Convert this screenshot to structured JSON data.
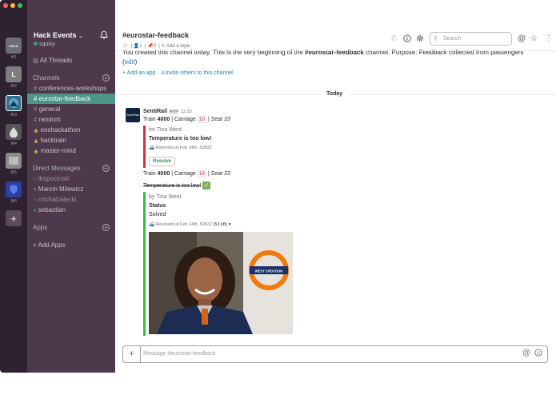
{
  "teams": {
    "items": [
      {
        "label": "HACK",
        "key": "⌘1",
        "color": "#6b6e73"
      },
      {
        "label": "L",
        "key": "⌘2",
        "color": "#7e7e80"
      },
      {
        "label": "",
        "key": "⌘3",
        "color": "#2f6f8a"
      },
      {
        "label": "",
        "key": "⌘4",
        "color": "#555"
      },
      {
        "label": "",
        "key": "⌘5",
        "color": "#8a8a8a"
      },
      {
        "label": "",
        "key": "⌘6",
        "color": "#2b3fa1"
      }
    ],
    "add": "+"
  },
  "sidebar": {
    "workspace": "Hack Events",
    "workspace_caret": "⌄",
    "username": "squixy",
    "all_threads": "All Threads",
    "channels_heading": "Channels",
    "channels": [
      {
        "prefix": "#",
        "label": "conferences-workshops"
      },
      {
        "prefix": "#",
        "label": "eurostar-feedback"
      },
      {
        "prefix": "#",
        "label": "general"
      },
      {
        "prefix": "#",
        "label": "random"
      },
      {
        "prefix": "🔒",
        "label": "eoshackathon"
      },
      {
        "prefix": "🔒",
        "label": "hacktrain"
      },
      {
        "prefix": "🔒",
        "label": "master-mind"
      }
    ],
    "dm_heading": "Direct Messages",
    "dms": [
      {
        "prefix": "○",
        "label": "lkopocinski"
      },
      {
        "prefix": "♥",
        "label": "Marcin Milewicz"
      },
      {
        "prefix": "○",
        "label": "michalzalecki"
      },
      {
        "prefix": "♥",
        "label": "sebastian"
      }
    ],
    "apps_heading": "Apps",
    "add_apps": "+ Add Apps"
  },
  "header": {
    "channel": "#eurostar-feedback",
    "star": "☆",
    "members": "1",
    "pins": "0",
    "add_topic": "Add a topic",
    "search_placeholder": "Search"
  },
  "intro": {
    "text": "You created this channel today. This is the very beginning of the",
    "channel": "#eurostar-feedback",
    "text2": "channel. Purpose: Feedback collected from passengers",
    "edit": "edit",
    "add_app": "+ Add an app",
    "invite": "Invite others to this channel"
  },
  "divider": "Today",
  "message": {
    "sender": "SentiRail",
    "badge": "APP",
    "time": "12:33",
    "avatar_text": "SentiRail",
    "line1": {
      "train_label": "Train",
      "train": "4000",
      "carriage_label": "| Carriage",
      "carriage": "10",
      "seat": "| Seat 33"
    },
    "att1": {
      "for": "for Tina West",
      "title": "Temperature is too low!",
      "meta": "Reported at  Feb 14th, 50832",
      "button": "Resolve",
      "bar_color": "#d72b3f"
    },
    "line2": {
      "train_label": "Train",
      "train": "4000",
      "carriage_label": "| Carriage",
      "carriage": "10",
      "seat": "| Seat 33"
    },
    "strike": "Temperature is too low!",
    "check": "✓",
    "att2": {
      "by": "by Tina West",
      "status_label": "Status",
      "status": "Solved",
      "meta": "Resolved at  Feb 14th, 50832",
      "size": "(53 kB) ▾",
      "bar_color": "#2fc43a"
    },
    "photo_sign": "WEST CROYDON"
  },
  "composer": {
    "placeholder": "Message #eurostar-feedback",
    "plus": "+"
  }
}
